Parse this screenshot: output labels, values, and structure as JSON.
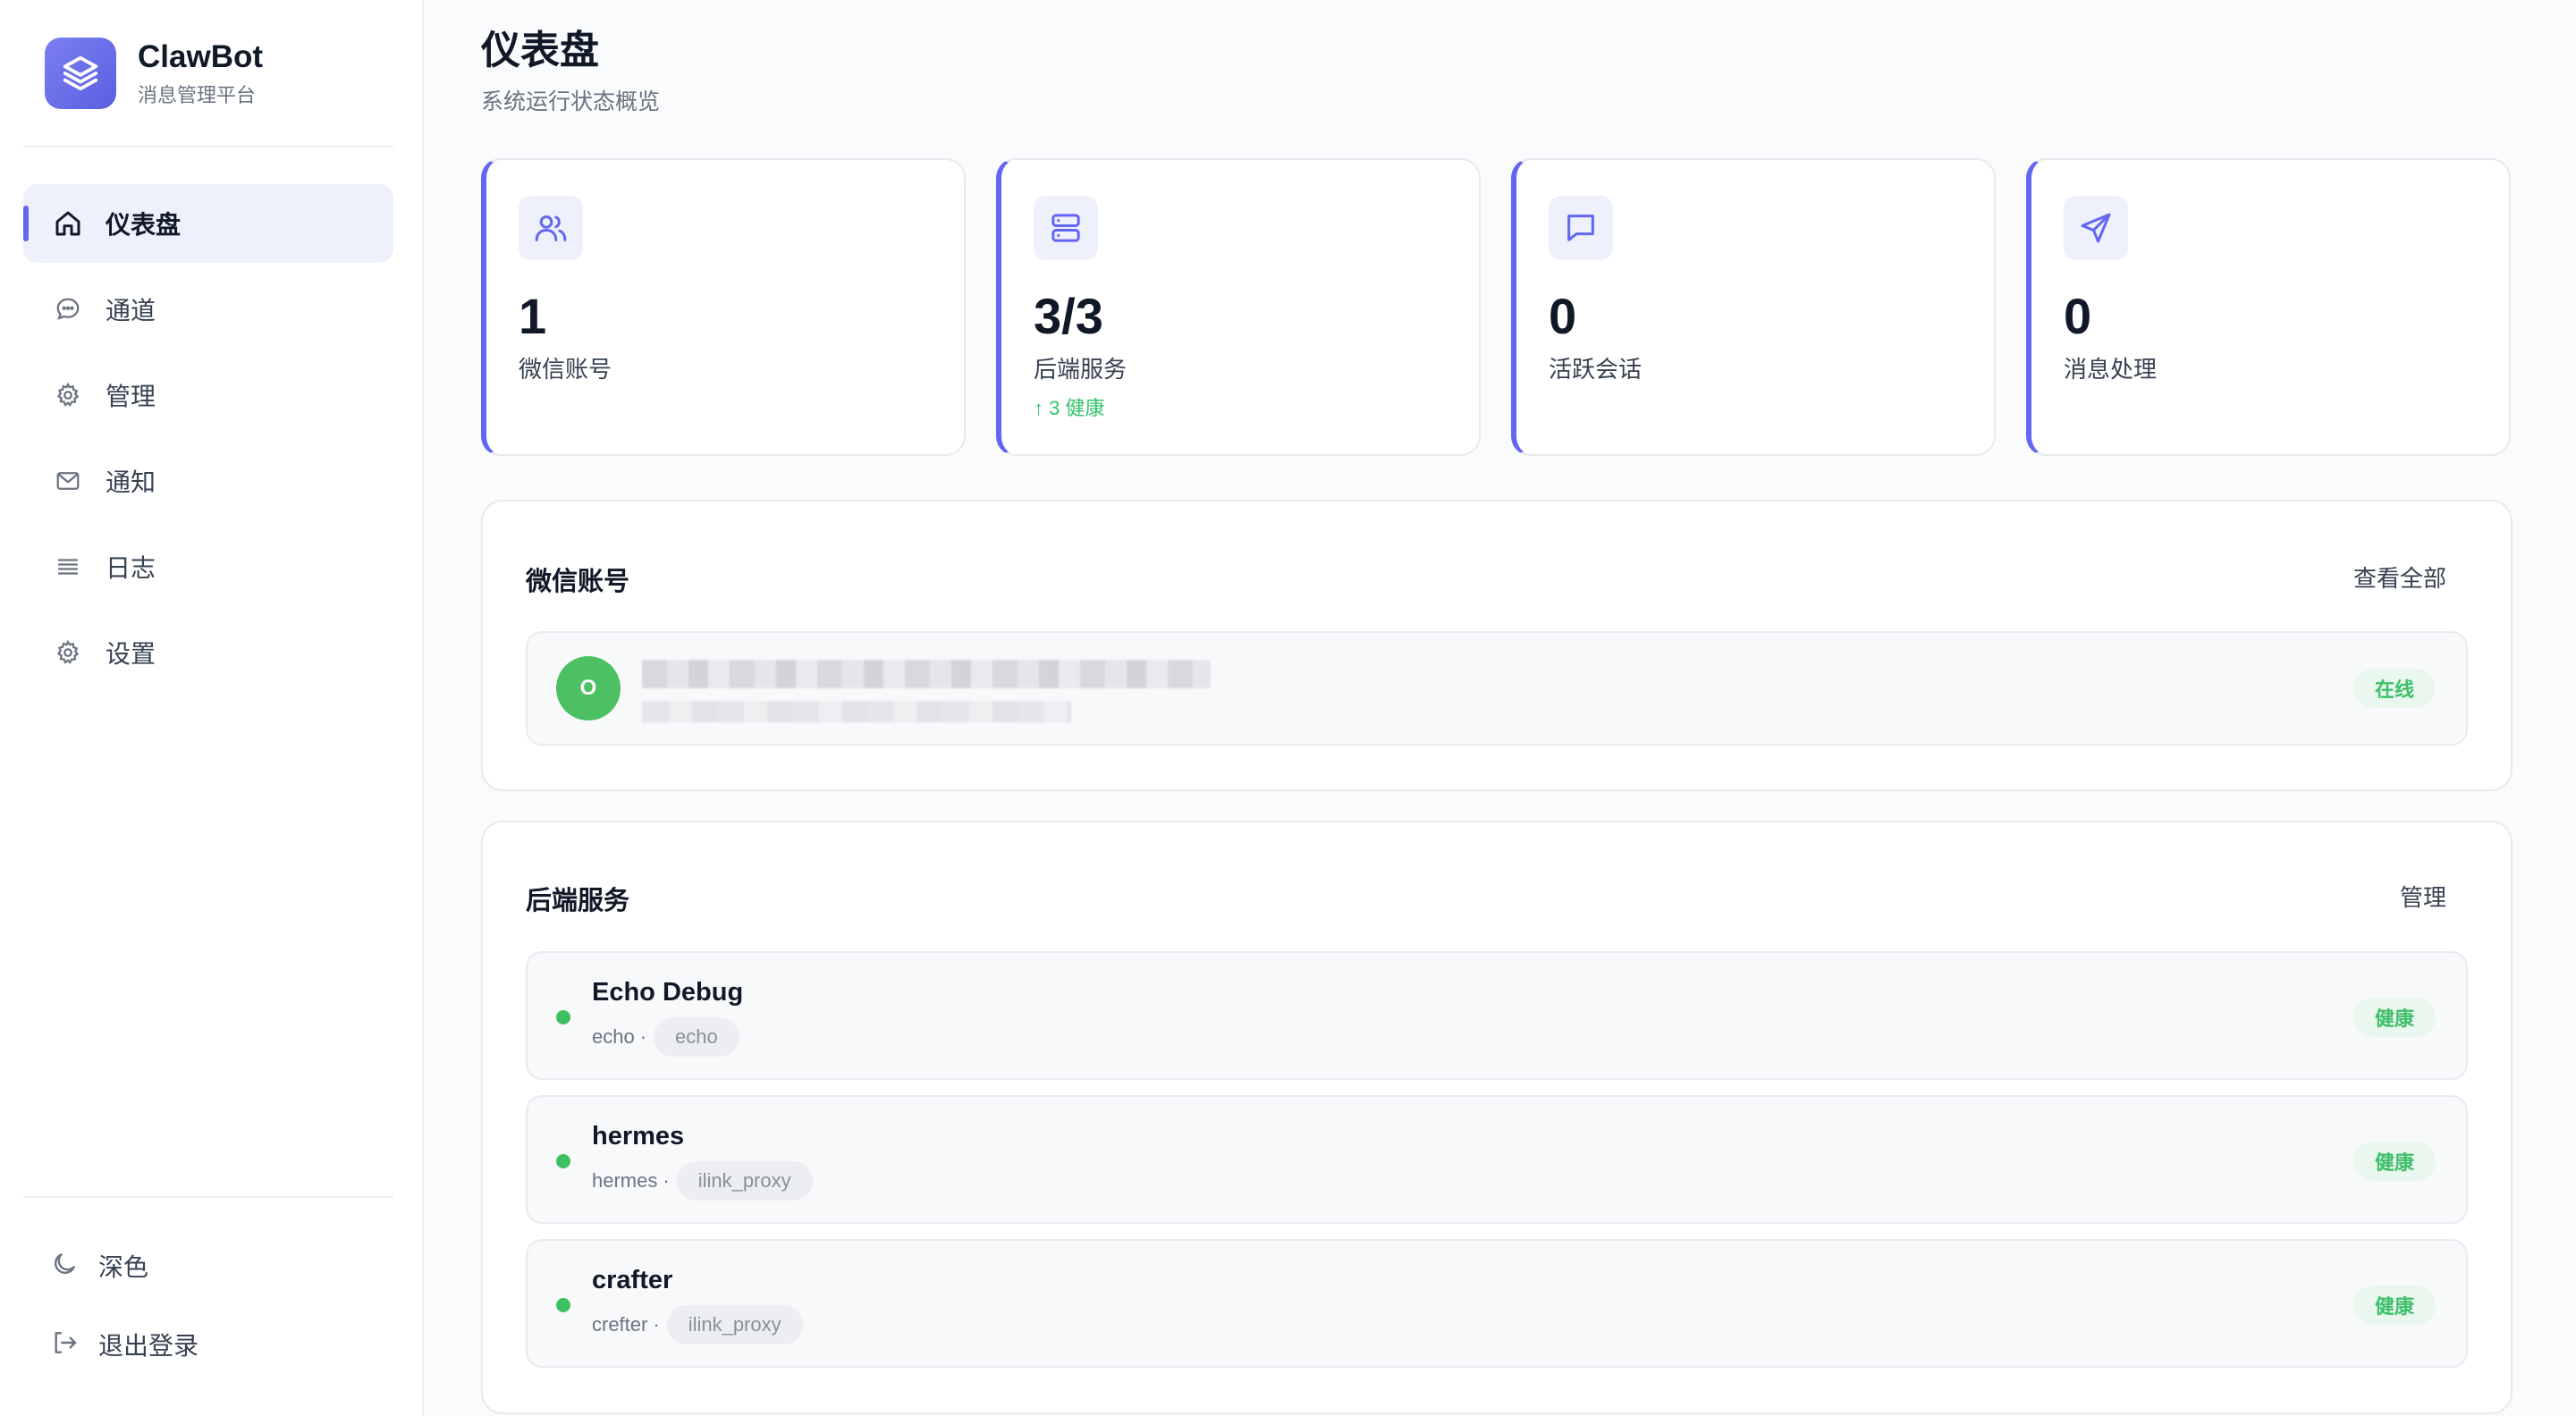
{
  "brand": {
    "name": "ClawBot",
    "subtitle": "消息管理平台",
    "icon": "layers-icon",
    "color": "#6366f1"
  },
  "sidebar": {
    "items": [
      {
        "label": "仪表盘",
        "icon": "home-icon",
        "active": true
      },
      {
        "label": "通道",
        "icon": "chat-bubble-icon",
        "active": false
      },
      {
        "label": "管理",
        "icon": "gear-icon",
        "active": false
      },
      {
        "label": "通知",
        "icon": "mail-icon",
        "active": false
      },
      {
        "label": "日志",
        "icon": "list-icon",
        "active": false
      },
      {
        "label": "设置",
        "icon": "gear-icon",
        "active": false
      }
    ],
    "bottom": [
      {
        "label": "深色",
        "icon": "moon-icon"
      },
      {
        "label": "退出登录",
        "icon": "logout-icon"
      }
    ]
  },
  "page": {
    "title": "仪表盘",
    "subtitle": "系统运行状态概览"
  },
  "stats": [
    {
      "value": "1",
      "label": "微信账号",
      "icon": "users-icon",
      "trend": ""
    },
    {
      "value": "3/3",
      "label": "后端服务",
      "icon": "server-icon",
      "trend": "↑ 3 健康"
    },
    {
      "value": "0",
      "label": "活跃会话",
      "icon": "message-square-icon",
      "trend": ""
    },
    {
      "value": "0",
      "label": "消息处理",
      "icon": "send-icon",
      "trend": ""
    }
  ],
  "accounts_panel": {
    "title": "微信账号",
    "action": "查看全部",
    "items": [
      {
        "avatar_letter": "O",
        "status": "在线"
      }
    ]
  },
  "services_panel": {
    "title": "后端服务",
    "action": "管理",
    "items": [
      {
        "name": "Echo Debug",
        "id": "echo",
        "type": "echo",
        "status": "健康"
      },
      {
        "name": "hermes",
        "id": "hermes",
        "type": "ilink_proxy",
        "status": "健康"
      },
      {
        "name": "crafter",
        "id": "crefter",
        "type": "ilink_proxy",
        "status": "健康"
      }
    ]
  },
  "colors": {
    "accent": "#6366f1",
    "success": "#3fbf6a",
    "avatar": "#4cc062"
  }
}
